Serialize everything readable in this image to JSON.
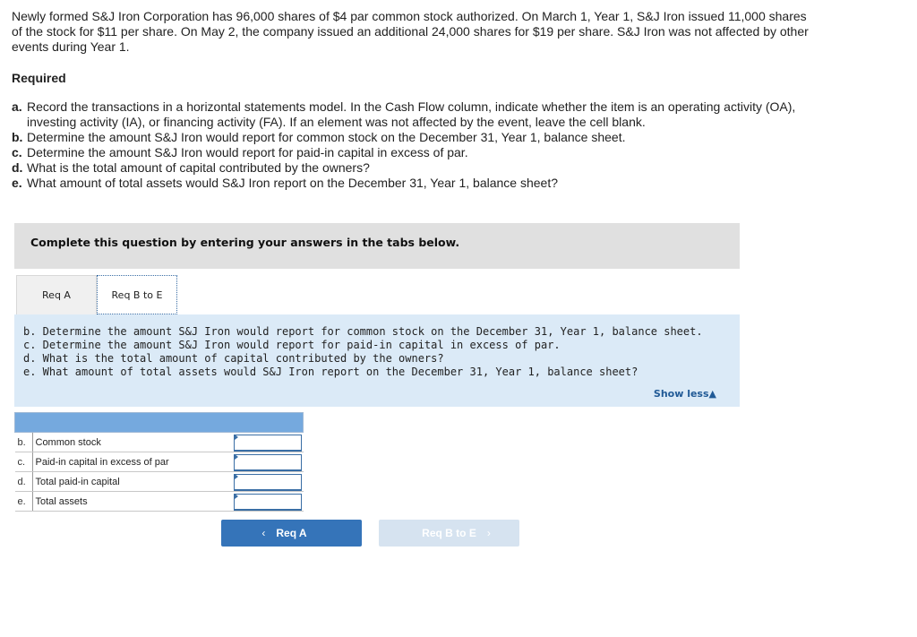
{
  "problem": {
    "intro": "Newly formed S&J Iron Corporation has 96,000 shares of $4 par common stock authorized. On March 1, Year 1, S&J Iron issued 11,000 shares of the stock for $11 per share. On May 2, the company issued an additional 24,000 shares for $19 per share. S&J Iron was not affected by other events during Year 1.",
    "required_heading": "Required",
    "requirements": [
      {
        "letter": "a.",
        "text": "Record the transactions in a horizontal statements model. In the Cash Flow column, indicate whether the item is an operating activity (OA), investing activity (IA), or financing activity (FA). If an element was not affected by the event, leave the cell blank."
      },
      {
        "letter": "b.",
        "text": "Determine the amount S&J Iron would report for common stock on the December 31, Year 1, balance sheet."
      },
      {
        "letter": "c.",
        "text": "Determine the amount S&J Iron would report for paid-in capital in excess of par."
      },
      {
        "letter": "d.",
        "text": "What is the total amount of capital contributed by the owners?"
      },
      {
        "letter": "e.",
        "text": "What amount of total assets would S&J Iron report on the December 31, Year 1, balance sheet?"
      }
    ]
  },
  "banner": {
    "text": "Complete this question by entering your answers in the tabs below."
  },
  "tabs": [
    {
      "label": "Req A",
      "active": false
    },
    {
      "label": "Req B to E",
      "active": true
    }
  ],
  "panel": {
    "lines": [
      "b. Determine the amount S&J Iron would report for common stock on the December 31, Year 1, balance sheet.",
      "c. Determine the amount S&J Iron would report for paid-in capital in excess of par.",
      "d. What is the total amount of capital contributed by the owners?",
      "e. What amount of total assets would S&J Iron report on the December 31, Year 1, balance sheet?"
    ],
    "show_less_label": "Show less",
    "show_less_icon": "triangle-up-icon"
  },
  "answer_table": {
    "rows": [
      {
        "letter": "b.",
        "label": "Common stock",
        "value": ""
      },
      {
        "letter": "c.",
        "label": "Paid-in capital in excess of par",
        "value": ""
      },
      {
        "letter": "d.",
        "label": "Total paid-in capital",
        "value": ""
      },
      {
        "letter": "e.",
        "label": "Total assets",
        "value": ""
      }
    ]
  },
  "navigation": {
    "prev_label": "Req A",
    "prev_icon": "chevron-left-icon",
    "next_label": "Req B to E",
    "next_icon": "chevron-right-icon",
    "next_disabled": true
  },
  "colors": {
    "accent": "#3574b9",
    "panel_bg": "#dbeaf7",
    "table_header": "#75a9de",
    "banner_bg": "#e0e0e0",
    "link": "#215a96"
  }
}
